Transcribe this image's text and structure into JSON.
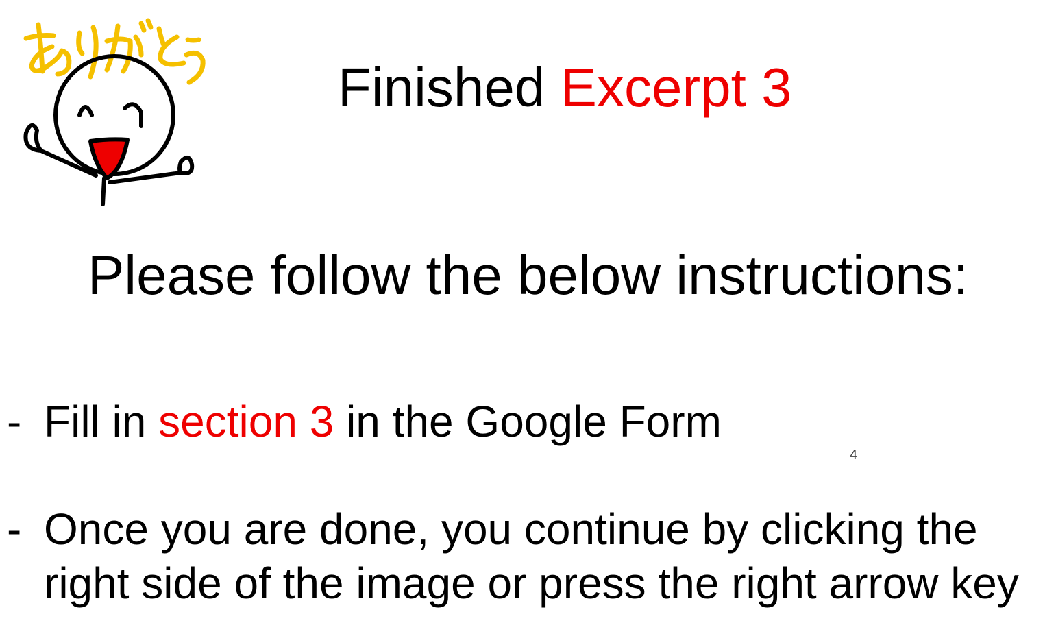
{
  "mascot": {
    "caption": "ありがとう",
    "icon": "smiling-stick-figure-drawing",
    "caption_color": "#f5c000",
    "mouth_color": "#ee0000"
  },
  "title": {
    "prefix": "Finished ",
    "highlight": "Excerpt 3",
    "highlight_color": "#ee0000"
  },
  "subtitle": "Please follow the below instructions:",
  "bullets": [
    {
      "dash": "-",
      "before": "Fill in ",
      "highlight": "section 3",
      "after": " in the Google Form"
    },
    {
      "dash": "-",
      "text": "Once you are done, you continue by clicking the right side of the image or press the right arrow key"
    }
  ],
  "page_number": "4"
}
